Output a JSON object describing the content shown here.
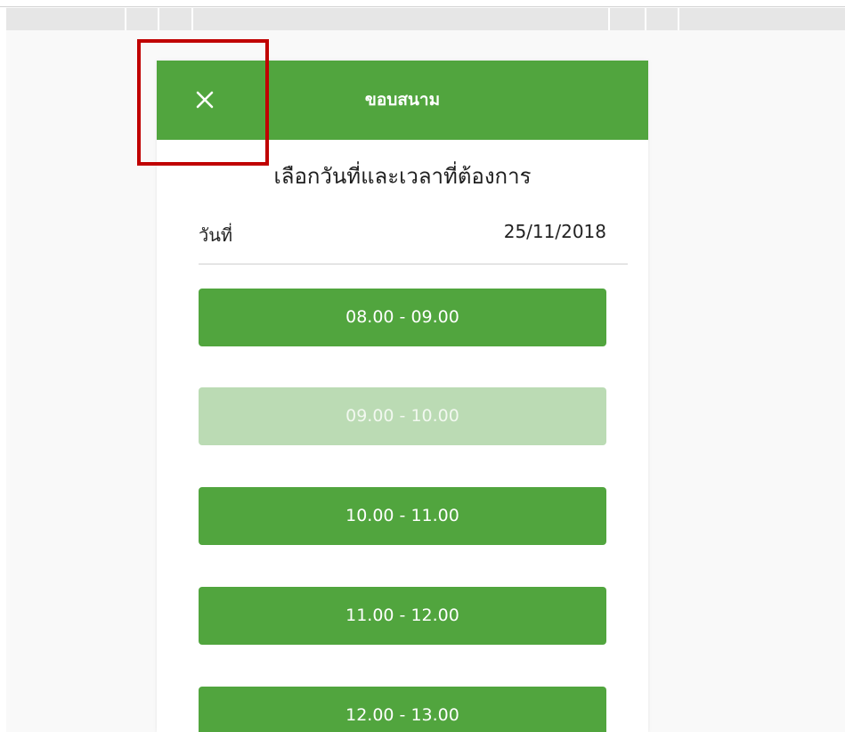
{
  "header": {
    "title": "ขอบสนาม",
    "close_icon": "close-icon"
  },
  "section_title": "เลือกวันที่และเวลาที่ต้องการ",
  "date": {
    "label": "วันที่",
    "value": "25/11/2018"
  },
  "time_slots": [
    {
      "label": "08.00 - 09.00",
      "available": true
    },
    {
      "label": "09.00 - 10.00",
      "available": false
    },
    {
      "label": "10.00 - 11.00",
      "available": true
    },
    {
      "label": "11.00 - 12.00",
      "available": true
    },
    {
      "label": "12.00 - 13.00",
      "available": true
    }
  ],
  "colors": {
    "accent": "#51a53e",
    "disabled": "#bbdbb4",
    "highlight": "#c00000"
  }
}
